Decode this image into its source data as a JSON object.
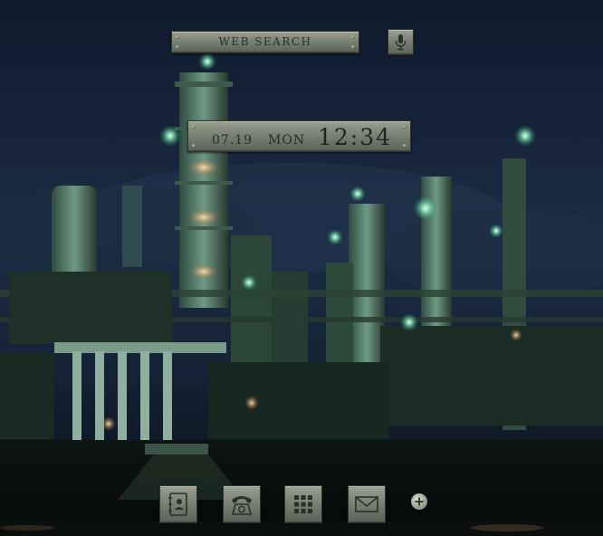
{
  "search": {
    "label": "WEB SEARCH"
  },
  "mic": {
    "icon": "microphone-icon"
  },
  "clock": {
    "date": "07.19",
    "day": "MON",
    "time": "12:34"
  },
  "dock": {
    "items": [
      {
        "icon": "contacts-book-icon"
      },
      {
        "icon": "telephone-icon"
      },
      {
        "icon": "app-grid-icon"
      },
      {
        "icon": "envelope-icon"
      }
    ],
    "add_icon": "plus-icon"
  },
  "colors": {
    "plate": "#80887a",
    "plate_text": "#262b24",
    "sky": "#0f1b2e",
    "plant_glow": "#7fe3b0"
  }
}
